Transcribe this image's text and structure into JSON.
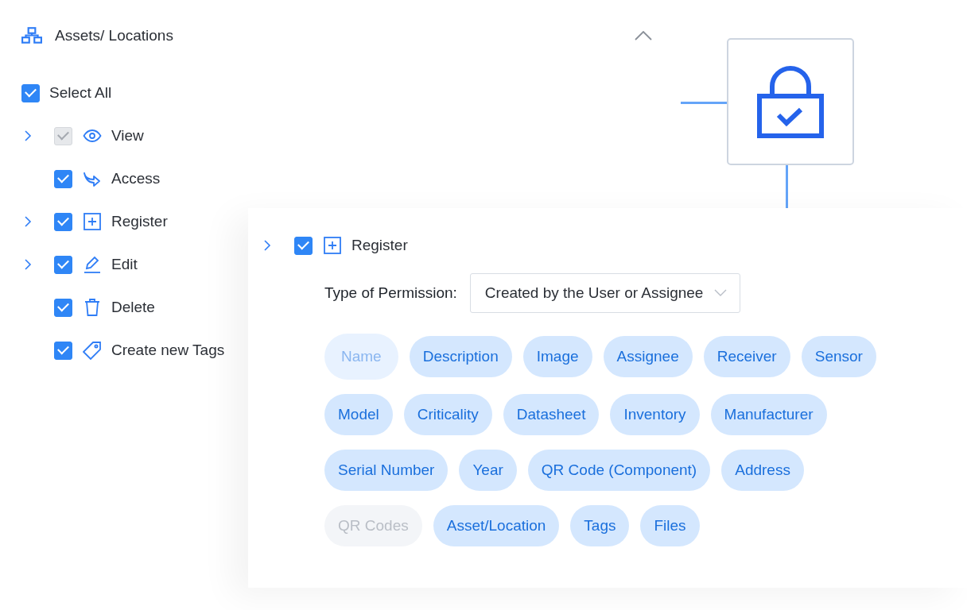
{
  "section": {
    "title": "Assets/ Locations",
    "collapsed": false
  },
  "select_all": {
    "label": "Select All",
    "checked": true
  },
  "permissions": [
    {
      "kind": "view",
      "label": "View",
      "checked": true,
      "disabled": true,
      "expandable": true
    },
    {
      "kind": "access",
      "label": "Access",
      "checked": true,
      "disabled": false,
      "expandable": false
    },
    {
      "kind": "register",
      "label": "Register",
      "checked": true,
      "disabled": false,
      "expandable": true
    },
    {
      "kind": "edit",
      "label": "Edit",
      "checked": true,
      "disabled": false,
      "expandable": true
    },
    {
      "kind": "delete",
      "label": "Delete",
      "checked": true,
      "disabled": false,
      "expandable": false
    },
    {
      "kind": "tag",
      "label": "Create new Tags",
      "checked": true,
      "disabled": false,
      "expandable": false
    }
  ],
  "detail": {
    "kind": "register",
    "label": "Register",
    "checked": true,
    "expandable": true,
    "permission_type": {
      "label": "Type of Permission:",
      "value": "Created by the User or Assignee"
    },
    "fields": [
      {
        "label": "Name",
        "kind": "fixed"
      },
      {
        "label": "Description",
        "kind": "on"
      },
      {
        "label": "Image",
        "kind": "on"
      },
      {
        "label": "Assignee",
        "kind": "on"
      },
      {
        "label": "Receiver",
        "kind": "on"
      },
      {
        "label": "Sensor",
        "kind": "on"
      },
      {
        "label": "Model",
        "kind": "on"
      },
      {
        "label": "Criticality",
        "kind": "on"
      },
      {
        "label": "Datasheet",
        "kind": "on"
      },
      {
        "label": "Inventory",
        "kind": "on"
      },
      {
        "label": "Manufacturer",
        "kind": "on"
      },
      {
        "label": "Serial Number",
        "kind": "on"
      },
      {
        "label": "Year",
        "kind": "on"
      },
      {
        "label": "QR Code (Component)",
        "kind": "on"
      },
      {
        "label": "Address",
        "kind": "on"
      },
      {
        "label": "QR Codes",
        "kind": "off"
      },
      {
        "label": "Asset/Location",
        "kind": "on"
      },
      {
        "label": "Tags",
        "kind": "on"
      },
      {
        "label": "Files",
        "kind": "on"
      }
    ]
  }
}
